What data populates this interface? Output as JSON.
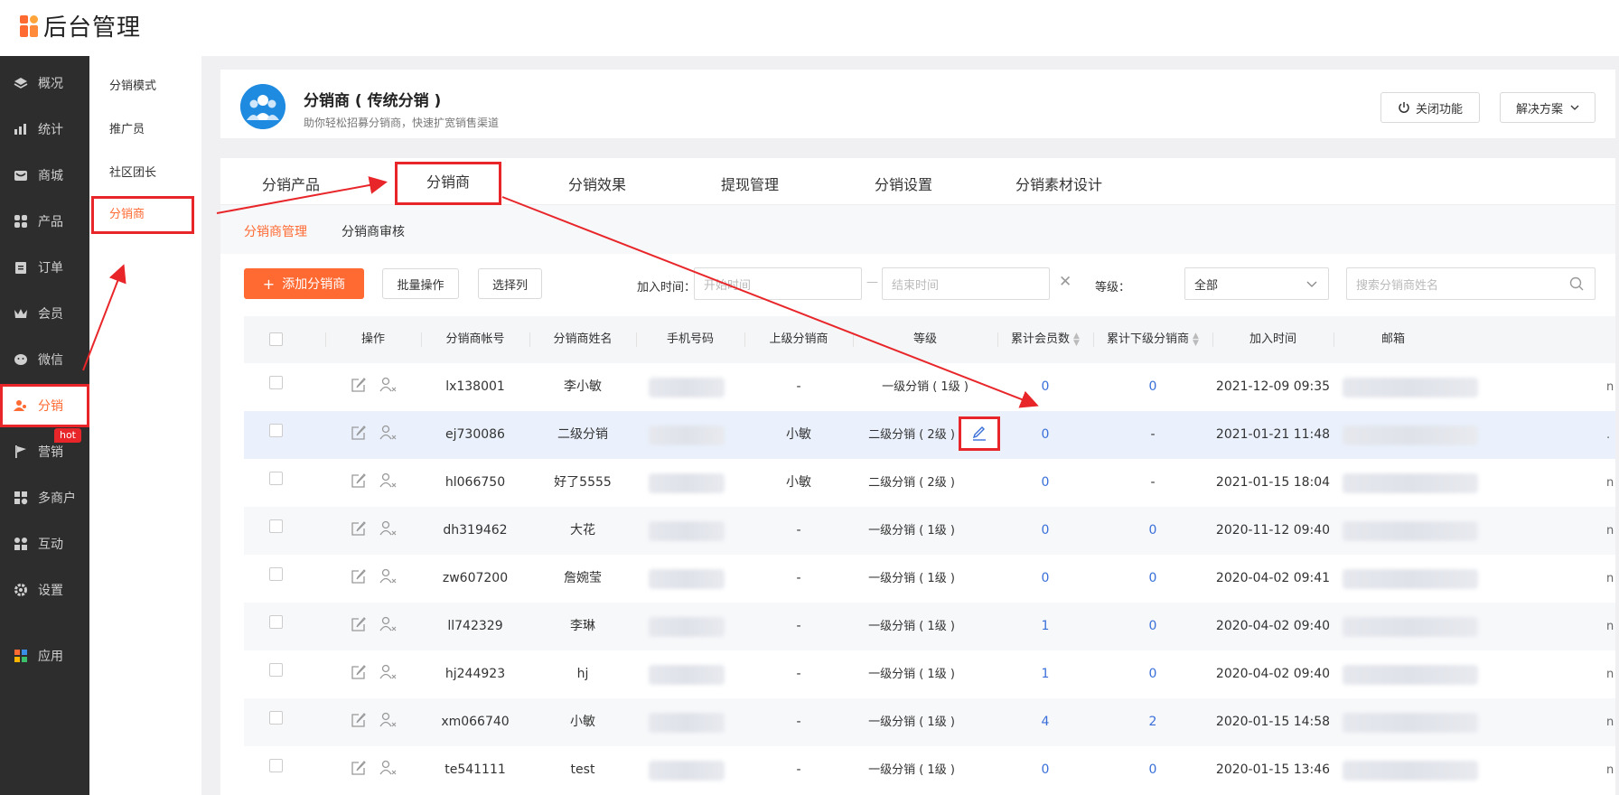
{
  "app": {
    "title": "后台管理"
  },
  "nav": {
    "items": [
      {
        "label": "概况",
        "icon": "layers-icon"
      },
      {
        "label": "统计",
        "icon": "chart-icon"
      },
      {
        "label": "商城",
        "icon": "store-icon"
      },
      {
        "label": "产品",
        "icon": "grid-icon"
      },
      {
        "label": "订单",
        "icon": "clipboard-icon"
      },
      {
        "label": "会员",
        "icon": "crown-icon"
      },
      {
        "label": "微信",
        "icon": "wechat-icon"
      },
      {
        "label": "分销",
        "icon": "distributor-icon",
        "active": true,
        "badge": "hot"
      },
      {
        "label": "营销",
        "icon": "flag-icon"
      },
      {
        "label": "多商户",
        "icon": "merchant-icon"
      },
      {
        "label": "互动",
        "icon": "people-icon"
      },
      {
        "label": "设置",
        "icon": "gear-icon"
      },
      {
        "label": "应用",
        "icon": "apps-icon"
      }
    ]
  },
  "subnav": {
    "items": [
      "分销模式",
      "推广员",
      "社区团长",
      "分销商"
    ],
    "active": "分销商"
  },
  "header": {
    "title": "分销商 ( 传统分销 )",
    "subtitle": "助你轻松招募分销商，快速扩宽销售渠道",
    "close_label": "关闭功能",
    "solution_label": "解决方案"
  },
  "tabs": [
    "分销产品",
    "分销商",
    "分销效果",
    "提现管理",
    "分销设置",
    "分销素材设计"
  ],
  "subtabs": [
    "分销商管理",
    "分销商审核"
  ],
  "toolbar": {
    "add_label": "添加分销商",
    "batch_label": "批量操作",
    "columns_label": "选择列",
    "join_time_label": "加入时间：",
    "start_placeholder": "开始时间",
    "end_placeholder": "结束时间",
    "level_label": "等级：",
    "level_value": "全部",
    "search_placeholder": "搜索分销商姓名"
  },
  "table": {
    "headers": [
      "操作",
      "分销商帐号",
      "分销商姓名",
      "手机号码",
      "上级分销商",
      "等级",
      "累计会员数",
      "累计下级分销商",
      "加入时间",
      "邮箱"
    ],
    "rows": [
      {
        "account": "lx138001",
        "name": "李小敏",
        "parent": "-",
        "level": "一级分销 ( 1级 )",
        "members": "0",
        "subs": "0",
        "joined": "2021-12-09 09:35",
        "email_tail": "n"
      },
      {
        "account": "ej730086",
        "name": "二级分销",
        "parent": "小敏",
        "level": "二级分销 ( 2级 )",
        "members": "0",
        "subs": "-",
        "joined": "2021-01-21 11:48",
        "email_tail": "."
      },
      {
        "account": "hl066750",
        "name": "好了5555",
        "parent": "小敏",
        "level": "二级分销 ( 2级 )",
        "members": "0",
        "subs": "-",
        "joined": "2021-01-15 18:04",
        "email_tail": "n"
      },
      {
        "account": "dh319462",
        "name": "大花",
        "parent": "-",
        "level": "一级分销 ( 1级 )",
        "members": "0",
        "subs": "0",
        "joined": "2020-11-12 09:40",
        "email_tail": "n"
      },
      {
        "account": "zw607200",
        "name": "詹婉莹",
        "parent": "-",
        "level": "一级分销 ( 1级 )",
        "members": "0",
        "subs": "0",
        "joined": "2020-04-02 09:41",
        "email_tail": "n"
      },
      {
        "account": "ll742329",
        "name": "李琳",
        "parent": "-",
        "level": "一级分销 ( 1级 )",
        "members": "1",
        "subs": "0",
        "joined": "2020-04-02 09:40",
        "email_tail": "n"
      },
      {
        "account": "hj244923",
        "name": "hj",
        "parent": "-",
        "level": "一级分销 ( 1级 )",
        "members": "1",
        "subs": "0",
        "joined": "2020-04-02 09:40",
        "email_tail": "n"
      },
      {
        "account": "xm066740",
        "name": "小敏",
        "parent": "-",
        "level": "一级分销 ( 1级 )",
        "members": "4",
        "subs": "2",
        "joined": "2020-01-15 14:58",
        "email_tail": "n"
      },
      {
        "account": "te541111",
        "name": "test",
        "parent": "-",
        "level": "一级分销 ( 1级 )",
        "members": "0",
        "subs": "0",
        "joined": "2020-01-15 13:46",
        "email_tail": "n"
      }
    ]
  },
  "colors": {
    "accent": "#ff6a33",
    "highlight": "#e8262a",
    "link": "#3a6fd9",
    "nav_bg": "#2d2d2d"
  }
}
